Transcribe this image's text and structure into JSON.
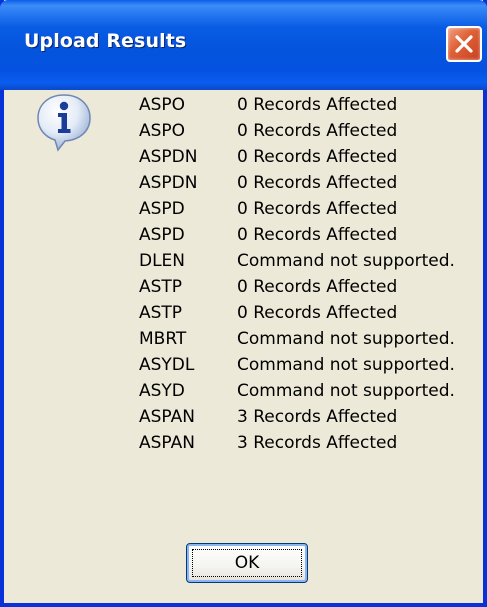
{
  "dialog": {
    "title": "Upload Results",
    "ok_label": "OK"
  },
  "results": [
    {
      "command": "ASPO",
      "message": "0 Records Affected"
    },
    {
      "command": "ASPO",
      "message": "0 Records Affected"
    },
    {
      "command": "ASPDN",
      "message": "0 Records Affected"
    },
    {
      "command": "ASPDN",
      "message": "0 Records Affected"
    },
    {
      "command": "ASPD",
      "message": "0 Records Affected"
    },
    {
      "command": "ASPD",
      "message": "0 Records Affected"
    },
    {
      "command": "DLEN",
      "message": "Command not supported."
    },
    {
      "command": "ASTP",
      "message": "0 Records Affected"
    },
    {
      "command": "ASTP",
      "message": "0 Records Affected"
    },
    {
      "command": "MBRT",
      "message": "Command not supported."
    },
    {
      "command": "ASYDL",
      "message": "Command not supported."
    },
    {
      "command": "ASYD",
      "message": "Command not supported."
    },
    {
      "command": "ASPAN",
      "message": "3 Records Affected"
    },
    {
      "command": "ASPAN",
      "message": "3 Records Affected"
    }
  ],
  "icons": {
    "dialog_icon": "info-icon",
    "close": "close-icon"
  },
  "colors": {
    "titlebar_blue": "#0454de",
    "close_red": "#e0633a",
    "dialog_background": "#ece9d8"
  }
}
